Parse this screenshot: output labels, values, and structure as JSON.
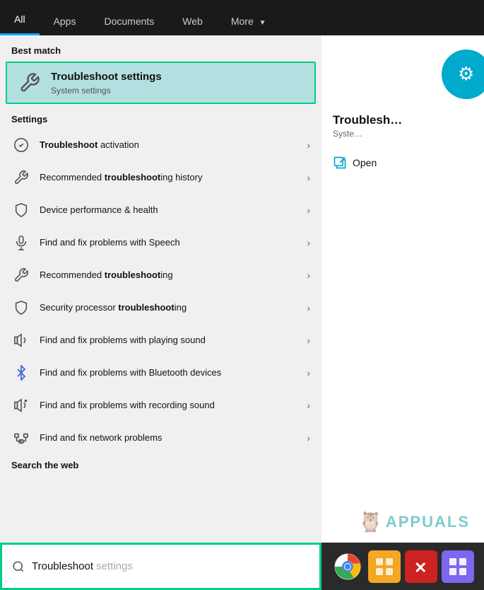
{
  "nav": {
    "tabs": [
      {
        "id": "all",
        "label": "All",
        "active": true
      },
      {
        "id": "apps",
        "label": "Apps"
      },
      {
        "id": "documents",
        "label": "Documents"
      },
      {
        "id": "web",
        "label": "Web"
      },
      {
        "id": "more",
        "label": "More",
        "hasChevron": true
      }
    ]
  },
  "best_match": {
    "section_label": "Best match",
    "title_part1": "Troubleshoot",
    "title_part2": " settings",
    "subtitle": "System settings",
    "icon": "wrench"
  },
  "settings": {
    "section_label": "Settings",
    "items": [
      {
        "id": "troubleshoot-activation",
        "text_bold": "Troubleshoot",
        "text_rest": " activation",
        "icon": "check-circle"
      },
      {
        "id": "recommended-troubleshoot-history",
        "text_prefix": "Recommended ",
        "text_bold": "troubleshoot",
        "text_suffix": "ing\nhistory",
        "icon": "wrench-small"
      },
      {
        "id": "device-performance",
        "text": "Device performance & health",
        "icon": "shield"
      },
      {
        "id": "speech-problems",
        "text": "Find and fix problems with Speech",
        "icon": "microphone"
      },
      {
        "id": "recommended-troubleshooting",
        "text_prefix": "Recommended ",
        "text_bold": "troubleshoot",
        "text_suffix": "ing",
        "icon": "wrench-small"
      },
      {
        "id": "security-processor",
        "text_prefix": "Security processor ",
        "text_bold": "troubleshoot",
        "text_suffix": "ing",
        "icon": "shield"
      },
      {
        "id": "playing-sound",
        "text": "Find and fix problems with playing\nsound",
        "icon": "sound"
      },
      {
        "id": "bluetooth",
        "text": "Find and fix problems with Bluetooth\ndevices",
        "icon": "bluetooth"
      },
      {
        "id": "recording-sound",
        "text": "Find and fix problems with recording\nsound",
        "icon": "sound"
      },
      {
        "id": "network",
        "text": "Find and fix network problems",
        "icon": "network"
      }
    ]
  },
  "search_web": {
    "section_label": "Search the web"
  },
  "search_bar": {
    "typed": "Troubleshoot",
    "placeholder": " settings"
  },
  "right_panel": {
    "title": "Troublesh",
    "subtitle": "Syste",
    "open_label": "Open"
  },
  "taskbar": {
    "icons": [
      {
        "id": "chrome",
        "color": "#4285F4",
        "label": "Chrome"
      },
      {
        "id": "square-app",
        "color": "#F5A623",
        "label": "Square App"
      },
      {
        "id": "app-x",
        "color": "#E84D4D",
        "label": "App X"
      },
      {
        "id": "grid-app",
        "color": "#7B68EE",
        "label": "Grid App"
      }
    ]
  },
  "watermark": {
    "text": "APPUALS"
  }
}
